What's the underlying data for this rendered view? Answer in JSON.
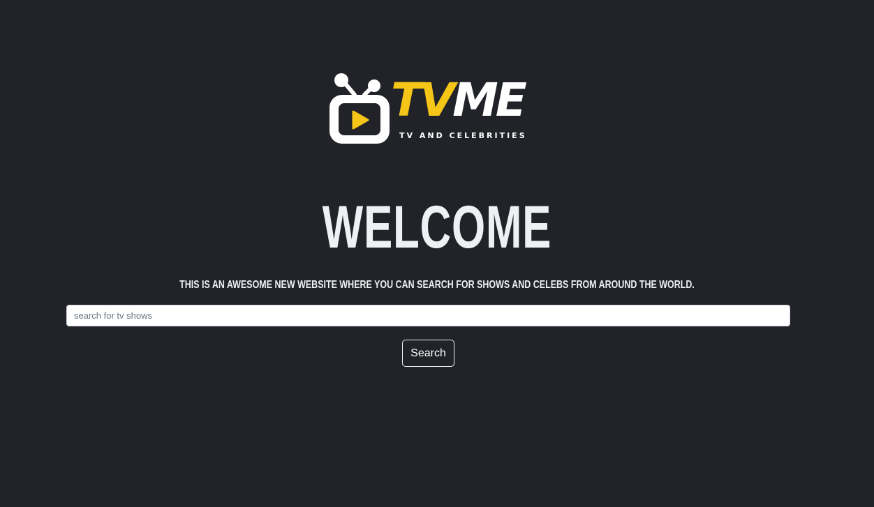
{
  "brand": {
    "wordmark_part1": "TV",
    "wordmark_part2": "ME",
    "tagline": "TV AND CELEBRITIES",
    "accent_color": "#f5c518",
    "icon": "tv-play-icon"
  },
  "hero": {
    "title": "WELCOME",
    "subtitle": "This is an awesome new website where you can search for shows and celebs from around the world."
  },
  "search": {
    "placeholder": "search for tv shows",
    "value": "",
    "button_label": "Search"
  },
  "colors": {
    "background": "#212328",
    "text": "#eef0f4"
  }
}
